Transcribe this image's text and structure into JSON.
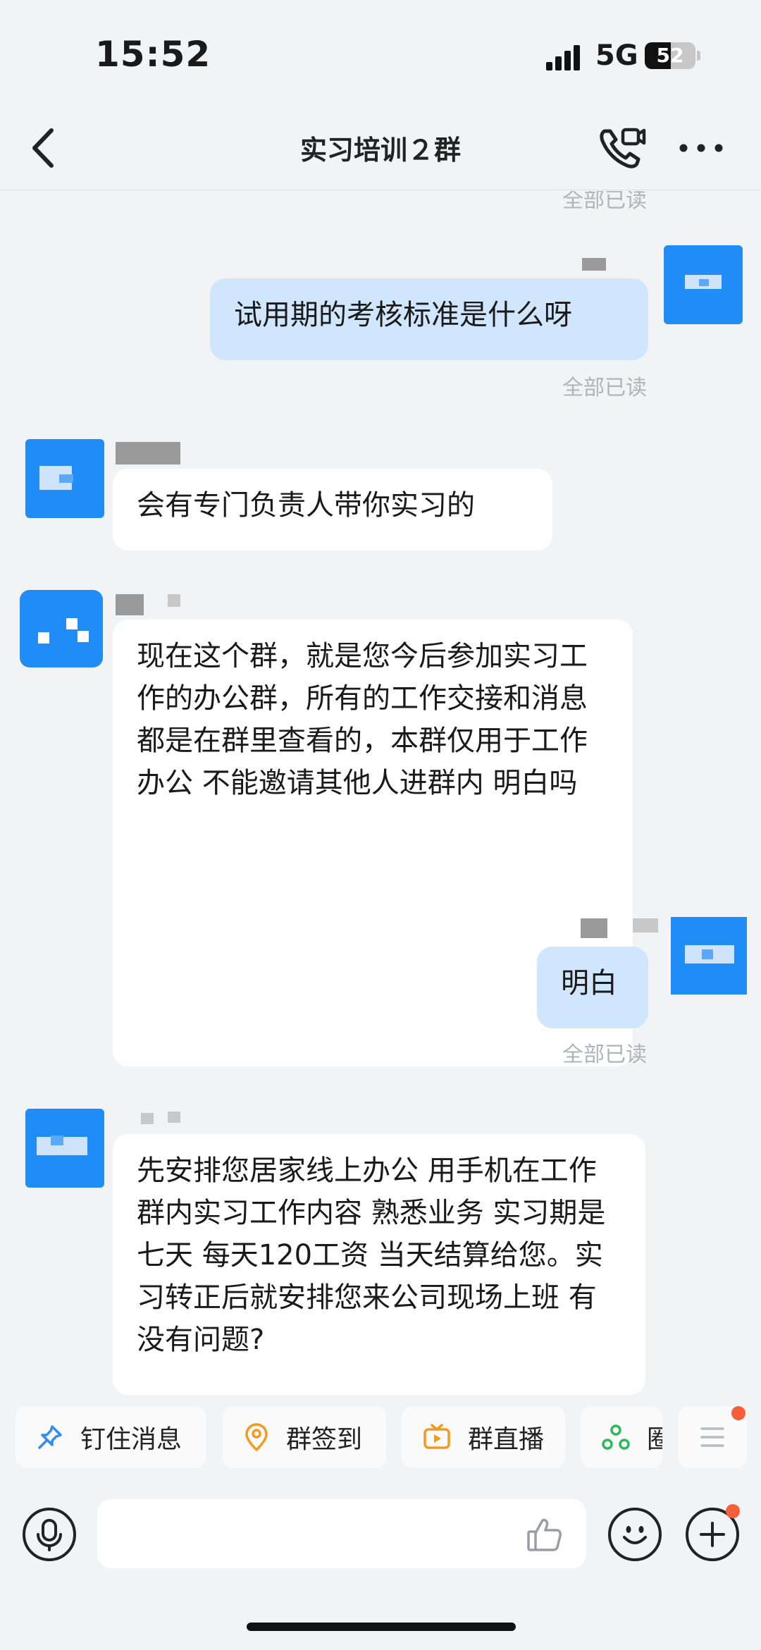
{
  "status_bar": {
    "time": "15:52",
    "network": "5G",
    "battery": "52"
  },
  "header": {
    "back_icon": "chevron-left-icon",
    "title": "实习培训２群",
    "call_icon": "video-call-icon",
    "more_icon": "more-dots-icon"
  },
  "chat": {
    "read_label": "全部已读",
    "messages": [
      {
        "direction": "out",
        "text": "试用期的考核标准是什么呀"
      },
      {
        "direction": "in",
        "text": "会有专门负责人带你实习的"
      },
      {
        "direction": "in",
        "text": "现在这个群，就是您今后参加实习工作的办公群，所有的工作交接和消息都是在群里查看的，本群仅用于工作办公 不能邀请其他人进群内 明白吗"
      },
      {
        "direction": "out",
        "text": "明白"
      },
      {
        "direction": "in",
        "text": "先安排您居家线上办公 用手机在工作群内实习工作内容 熟悉业务 实习期是七天 每天120工资 当天结算给您。实习转正后就安排您来公司现场上班 有没有问题?"
      }
    ]
  },
  "quick_actions": [
    {
      "label": "钉住消息",
      "icon": "pin-icon",
      "color": "#2f8cf0"
    },
    {
      "label": "群签到",
      "icon": "location-checkin-icon",
      "color": "#f29b22"
    },
    {
      "label": "群直播",
      "icon": "tv-live-icon",
      "color": "#f29b22"
    },
    {
      "label": "圈",
      "icon": "group-circle-icon",
      "color": "#2eb85c"
    }
  ],
  "input_bar": {
    "voice_icon": "microphone-icon",
    "like_icon": "thumbs-up-icon",
    "emoji_icon": "emoji-icon",
    "plus_icon": "plus-icon",
    "placeholder": ""
  },
  "colors": {
    "accent": "#1f8df5",
    "out_bubble": "#cfe6fd",
    "in_bubble": "#ffffff",
    "background": "#f2f3f5",
    "badge": "#f5603a"
  }
}
